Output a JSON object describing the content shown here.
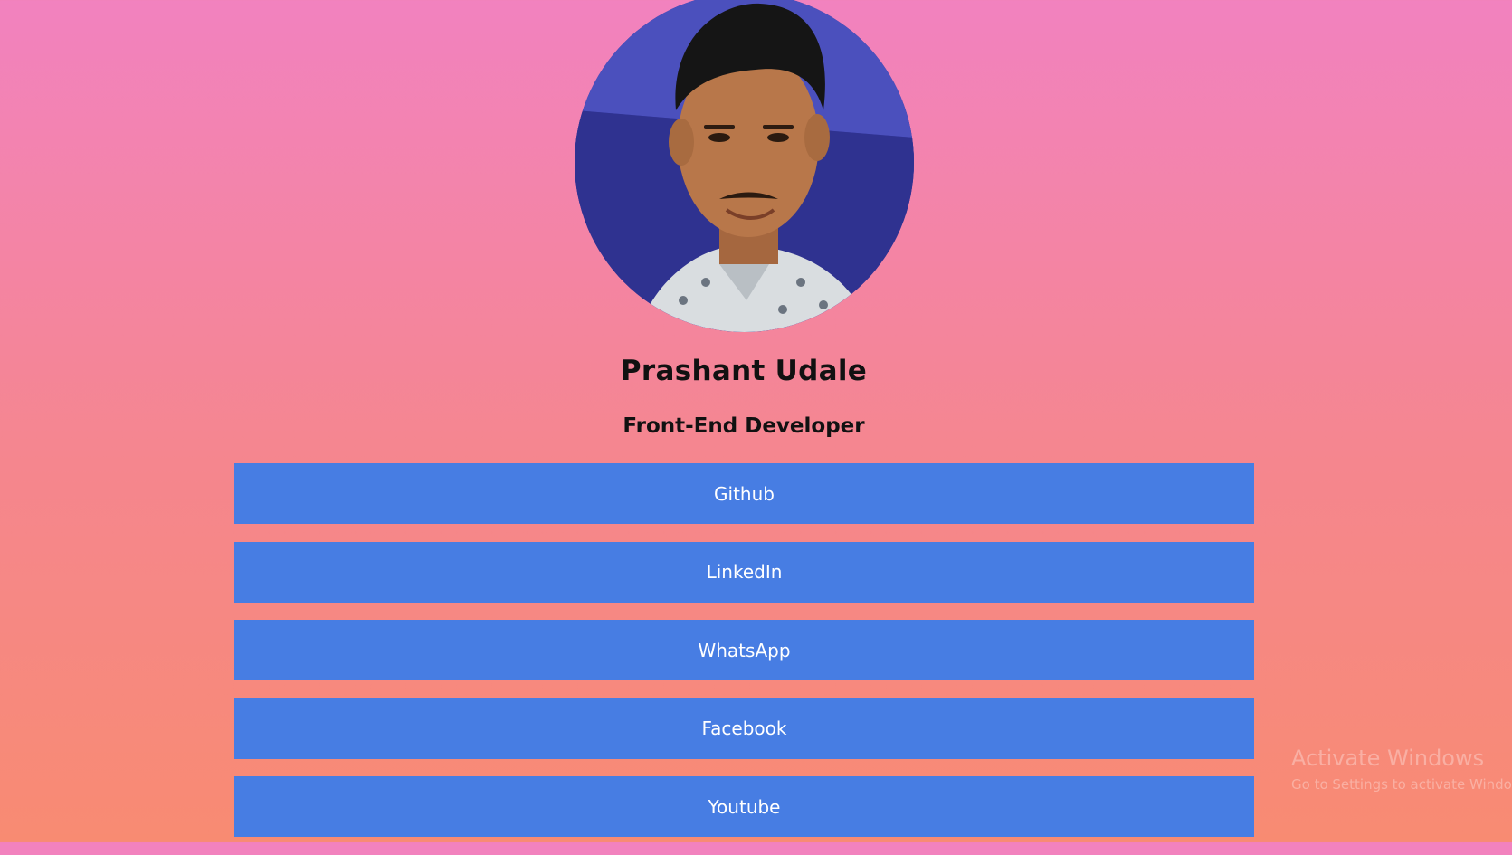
{
  "profile": {
    "name": "Prashant Udale",
    "role": "Front-End Developer",
    "avatar_alt": "profile-photo"
  },
  "links": [
    {
      "label": "Github"
    },
    {
      "label": "LinkedIn"
    },
    {
      "label": "WhatsApp"
    },
    {
      "label": "Facebook"
    },
    {
      "label": "Youtube"
    }
  ],
  "watermark": {
    "title": "Activate Windows",
    "subtitle": "Go to Settings to activate Windows."
  },
  "colors": {
    "button": "#477de3",
    "gradient_top": "#f282bf",
    "gradient_bottom": "#f88b72"
  }
}
